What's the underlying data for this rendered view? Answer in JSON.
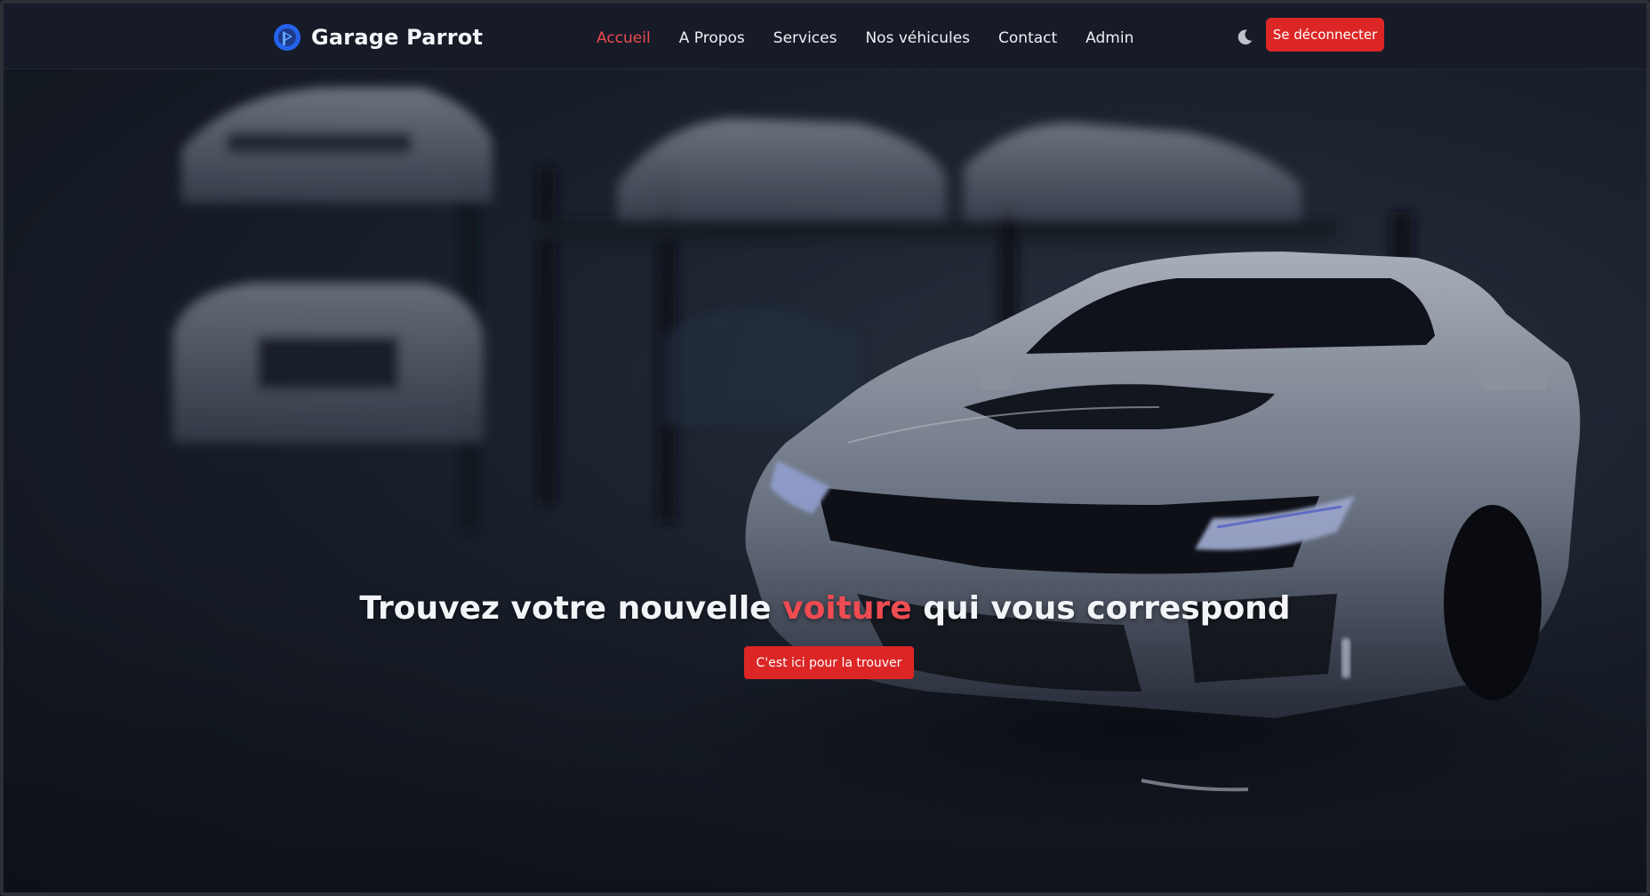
{
  "brand": {
    "name": "Garage Parrot",
    "logo_icon": "parrot-logo-icon",
    "logo_color": "#2563eb"
  },
  "nav": {
    "items": [
      {
        "label": "Accueil",
        "active": true
      },
      {
        "label": "A Propos",
        "active": false
      },
      {
        "label": "Services",
        "active": false
      },
      {
        "label": "Nos véhicules",
        "active": false
      },
      {
        "label": "Contact",
        "active": false
      },
      {
        "label": "Admin",
        "active": false
      }
    ]
  },
  "header": {
    "theme_toggle_icon": "moon-icon",
    "logout_label": "Se déconnecter"
  },
  "hero": {
    "headline_before": "Trouvez votre nouvelle ",
    "headline_accent": "voiture",
    "headline_after": " qui vous correspond",
    "cta_label": "C'est ici pour la trouver",
    "background": "dark garage showroom photo with white cars"
  },
  "colors": {
    "accent": "#dc2626",
    "accent_text": "#ef4b52",
    "nav_bg": "#161b27"
  }
}
